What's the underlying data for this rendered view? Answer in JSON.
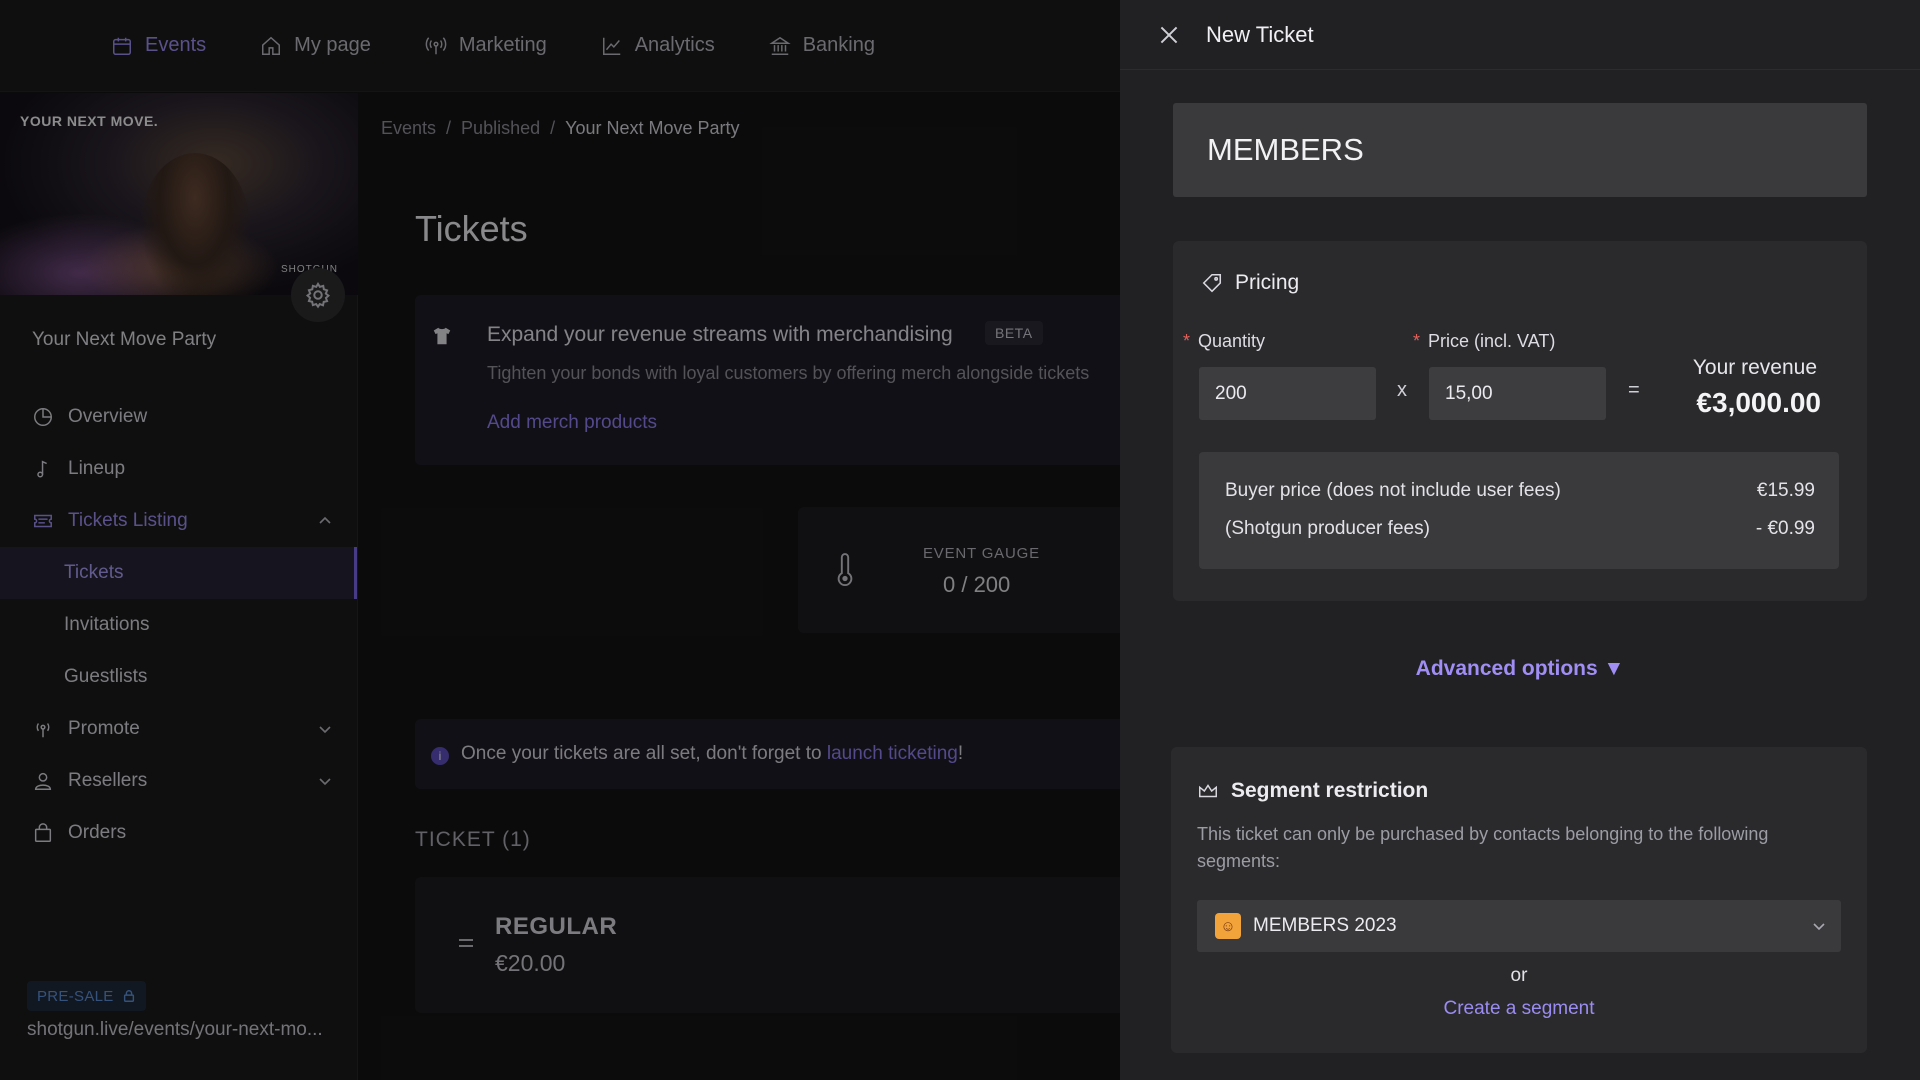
{
  "topnav": {
    "items": [
      {
        "label": "Events",
        "icon": "calendar-icon"
      },
      {
        "label": "My page",
        "icon": "home-icon"
      },
      {
        "label": "Marketing",
        "icon": "broadcast-icon"
      },
      {
        "label": "Analytics",
        "icon": "chart-line-icon"
      },
      {
        "label": "Banking",
        "icon": "bank-icon"
      }
    ]
  },
  "sidebar": {
    "banner_title": "YOUR NEXT MOVE.",
    "banner_brand": "SHOTGUN",
    "event_name": "Your Next Move Party",
    "items": [
      {
        "label": "Overview",
        "icon": "pie-chart-icon"
      },
      {
        "label": "Lineup",
        "icon": "music-note-icon"
      },
      {
        "label": "Tickets Listing",
        "icon": "ticket-icon"
      },
      {
        "label": "Promote",
        "icon": "broadcast-icon"
      },
      {
        "label": "Resellers",
        "icon": "user-icon"
      },
      {
        "label": "Orders",
        "icon": "shopping-bag-icon"
      }
    ],
    "sub_items": [
      {
        "label": "Tickets"
      },
      {
        "label": "Invitations"
      },
      {
        "label": "Guestlists"
      }
    ],
    "presale_badge": "PRE-SALE",
    "event_url": "shotgun.live/events/your-next-mo..."
  },
  "main": {
    "breadcrumb": [
      "Events",
      "Published",
      "Your Next Move Party"
    ],
    "breadcrumb_sep": "/",
    "title": "Tickets",
    "merch": {
      "title": "Expand your revenue streams with merchandising",
      "badge": "BETA",
      "desc": "Tighten your bonds with loyal customers by offering merch alongside tickets",
      "link": "Add merch products"
    },
    "gauge": {
      "label": "EVENT GAUGE",
      "value": "0 / 200"
    },
    "info": {
      "text_before": "Once your tickets are all set, don't forget to ",
      "link": "launch ticketing",
      "text_after": "!"
    },
    "ticket_count": "TICKET (1)",
    "ticket": {
      "name": "REGULAR",
      "price": "€20.00"
    }
  },
  "panel": {
    "title": "New Ticket",
    "ticket_name": "MEMBERS",
    "pricing": {
      "heading": "Pricing",
      "quantity_label": "Quantity",
      "quantity_value": "200",
      "price_label": "Price (incl. VAT)",
      "price_value": "15,00",
      "times": "x",
      "equals": "=",
      "revenue_label": "Your revenue",
      "revenue_value": "€3,000.00",
      "buyer_label": "Buyer price (does not include user fees)",
      "buyer_value": "€15.99",
      "fees_label": "(Shotgun producer fees)",
      "fees_value": "- €0.99"
    },
    "advanced_options": "Advanced options ▼",
    "segment": {
      "heading": "Segment restriction",
      "desc": "This ticket can only be purchased by contacts belonging to the following segments:",
      "selected": "MEMBERS 2023",
      "or": "or",
      "create": "Create a segment"
    }
  },
  "colors": {
    "accent": "#9b8cf0",
    "panel_bg": "#212123",
    "required": "#e0625c",
    "presale": "#5c8ed8"
  }
}
